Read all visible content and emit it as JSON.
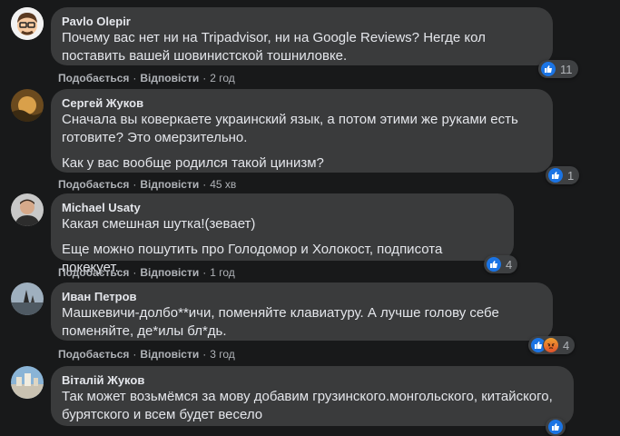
{
  "actions": {
    "like": "Подобається",
    "reply": "Відповісти"
  },
  "comments": [
    {
      "author": "Pavlo Olepir",
      "paragraphs": [
        "Почему вас нет ни на Tripadvisor, ни на Google Reviews? Негде кол поставить вашей шовинистской тошниловке."
      ],
      "time": "2 год",
      "reaction_count": "11",
      "reactions": [
        "like"
      ]
    },
    {
      "author": "Сергей Жуков",
      "paragraphs": [
        "Сначала вы коверкаете украинский язык, а потом этими же руками есть готовите? Это омерзительно.",
        "Как у вас вообще родился такой цинизм?"
      ],
      "time": "45 хв",
      "reaction_count": "1",
      "reactions": [
        "like"
      ]
    },
    {
      "author": "Michael Usaty",
      "paragraphs": [
        "Какая смешная шутка!(зевает)",
        "Еще можно пошутить про Голодомор и Холокост, подписота покекует."
      ],
      "time": "1 год",
      "reaction_count": "4",
      "reactions": [
        "like"
      ]
    },
    {
      "author": "Иван Петров",
      "paragraphs": [
        "Машкевичи-долбо**ичи, поменяйте клавиатуру. А лучше голову себе поменяйте, де*илы бл*дь."
      ],
      "time": "3 год",
      "reaction_count": "4",
      "reactions": [
        "like",
        "angry"
      ]
    },
    {
      "author": "Віталій Жуков",
      "paragraphs": [
        "Так может возьмёмся за мову добавим грузинского.монгольского, китайского, бурятского и всем будет весело"
      ],
      "time": "",
      "reaction_count": "",
      "reactions": [
        "like"
      ]
    }
  ]
}
